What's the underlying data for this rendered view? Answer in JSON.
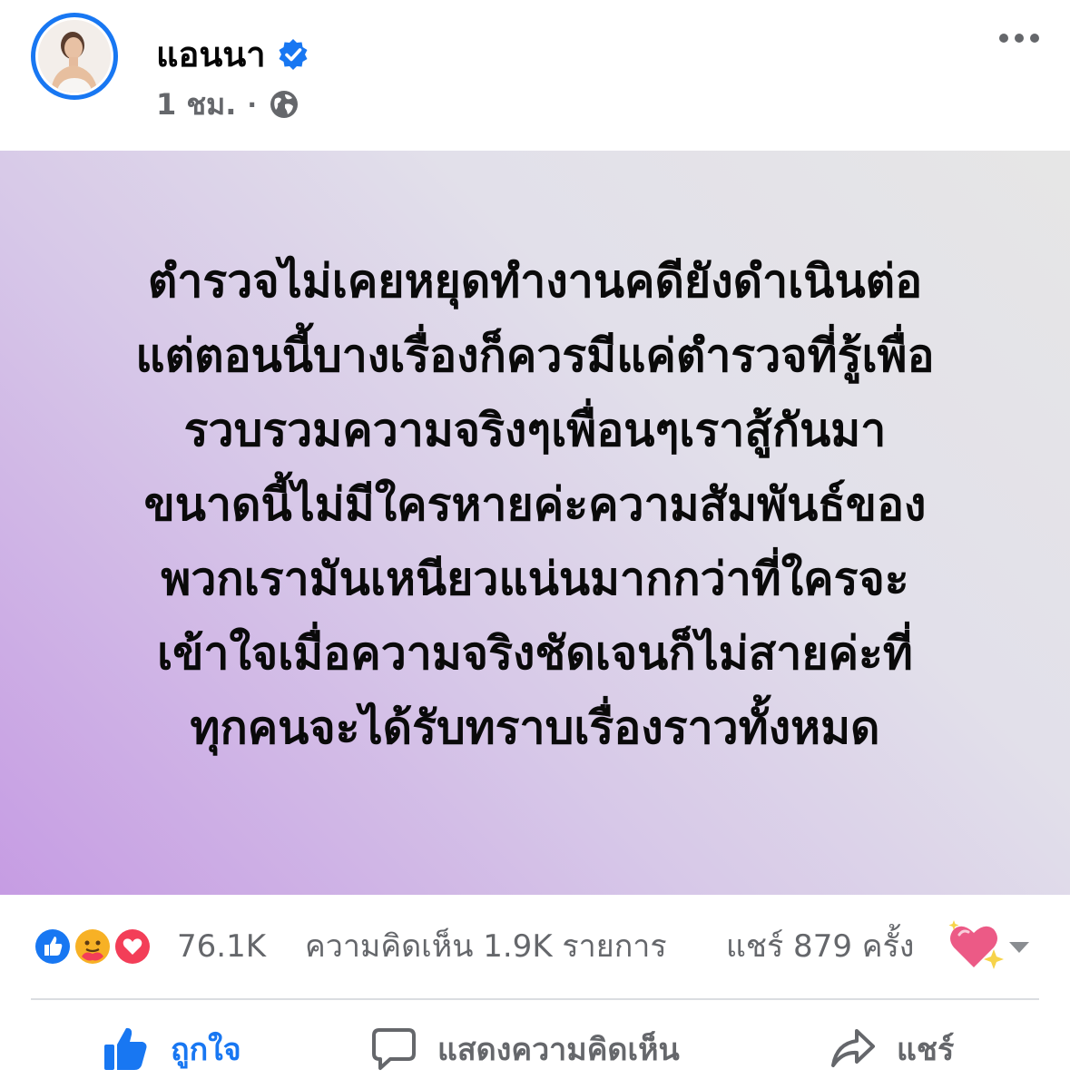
{
  "header": {
    "author": "แอนนา",
    "time": "1 ชม.",
    "separator": "·",
    "privacy_icon": "globe-icon",
    "verified_icon": "verified-badge-icon",
    "menu_icon": "more-horizontal-icon"
  },
  "post": {
    "text": "ตำรวจไม่เคยหยุดทำงานคดียังดำเนินต่อ\nแต่ตอนนี้บางเรื่องก็ควรมีแค่ตำรวจที่รู้เพื่อ\nรวบรวมความจริงๆเพื่อนๆเราสู้กันมา\nขนาดนี้ไม่มีใครหายค่ะความสัมพันธ์ของ\nพวกเรามันเหนียวแน่นมากกว่าที่ใครจะ\nเข้าใจเมื่อความจริงชัดเจนก็ไม่สายค่ะที่\nทุกคนจะได้รับทราบเรื่องราวทั้งหมด",
    "background_gradient": [
      "#c69ce3",
      "#e6e6e6"
    ]
  },
  "stats": {
    "reaction_icons": [
      "like-reaction-icon",
      "care-reaction-icon",
      "love-reaction-icon"
    ],
    "reactions": "76.1K",
    "comments": "ความคิดเห็น 1.9K รายการ",
    "shares": "แชร์ 879 ครั้ง"
  },
  "actions": {
    "like": "ถูกใจ",
    "comment": "แสดงความคิดเห็น",
    "share": "แชร์"
  },
  "colors": {
    "accent": "#1877f2",
    "muted": "#65676b",
    "love": "#f33e58",
    "care": "#f7b125"
  }
}
